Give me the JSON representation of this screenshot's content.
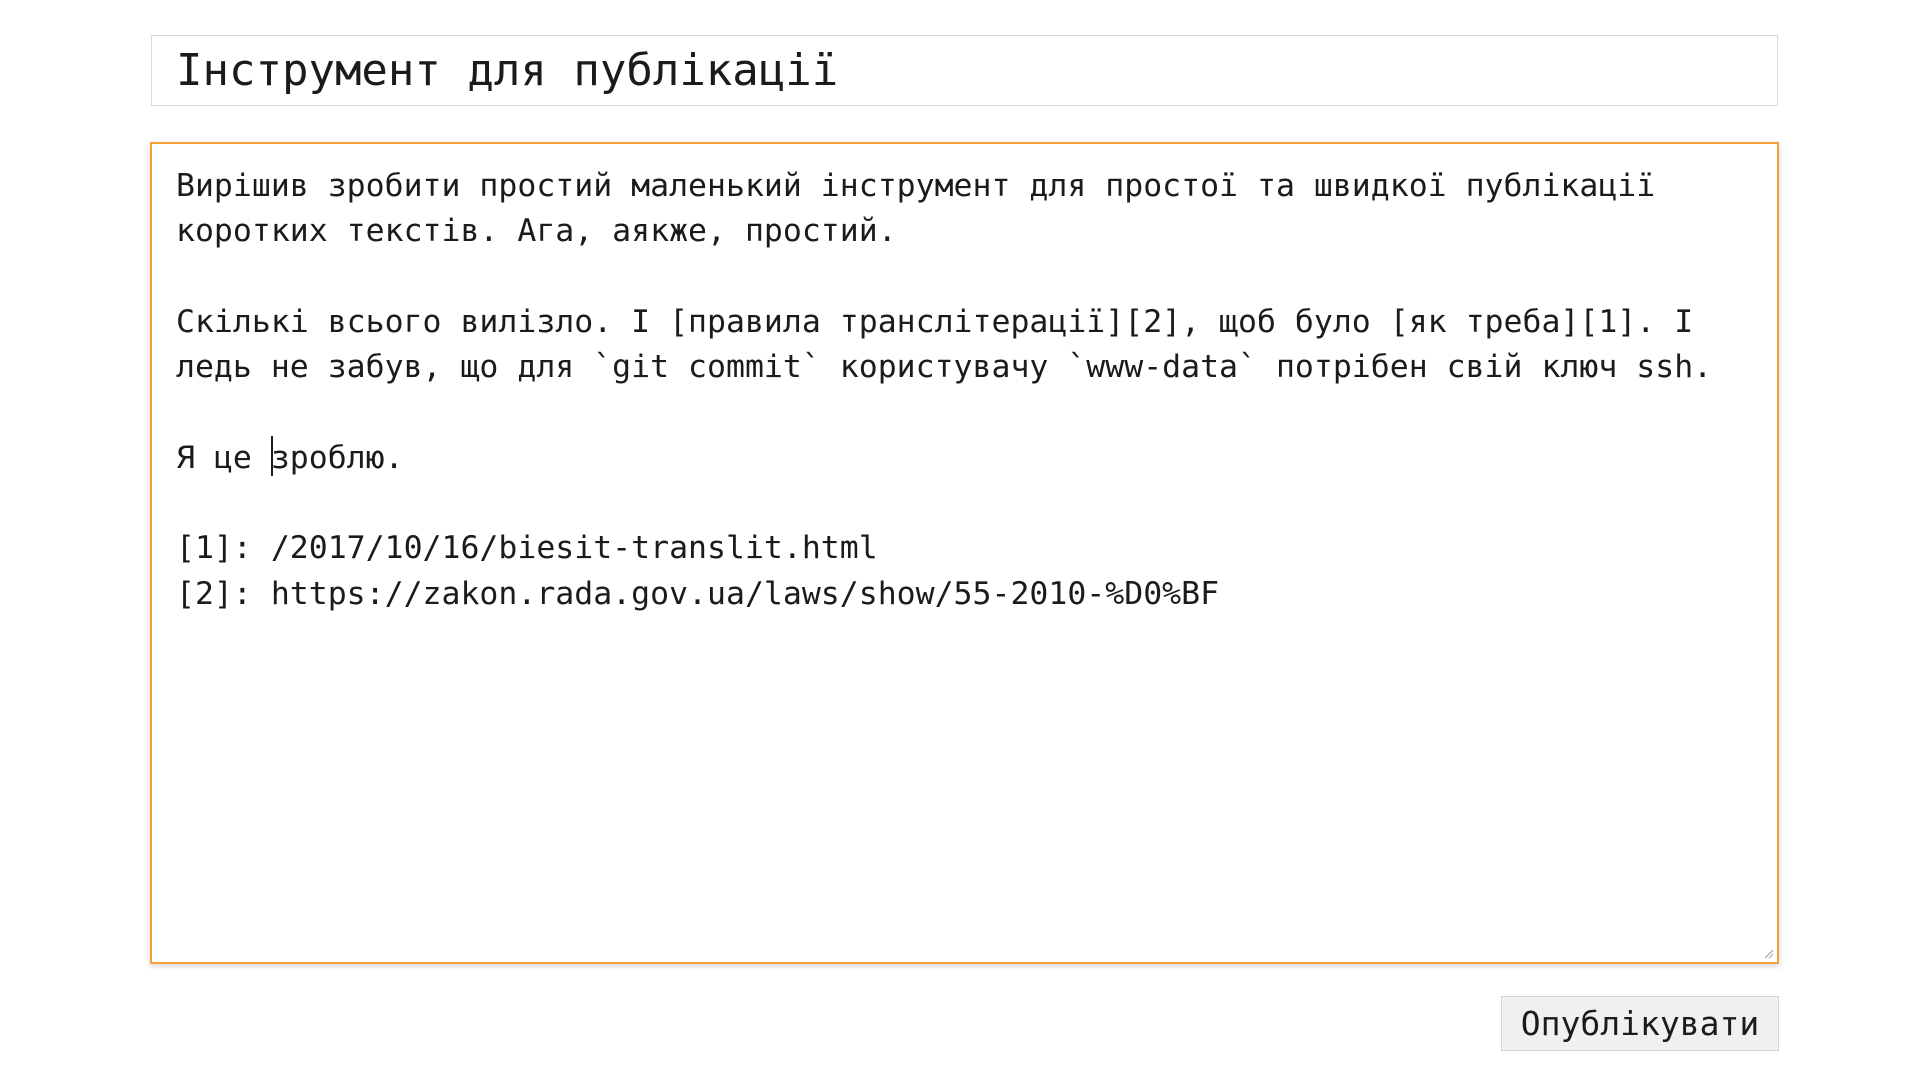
{
  "editor": {
    "title_value": "Інструмент для публікації",
    "body": {
      "line_1": "Вирішив зробити простий маленький інструмент для простої та швидкої публікації коротких текстів. Ага, аякже, простий.",
      "line_2": "Скількі всього вилізло. І [правила транслітерації][2], щоб було [як треба][1]. І ледь не забув, що для `git commit` користувачу `www-data` потрібен свій ключ ssh.",
      "line_3_before_caret": "Я це ",
      "line_3_after_caret": "зроблю.",
      "ref_1": "[1]: /2017/10/16/biesit-translit.html",
      "ref_2": "[2]: https://zakon.rada.gov.ua/laws/show/55-2010-%D0%BF"
    }
  },
  "actions": {
    "publish_label": "Опублікувати"
  },
  "colors": {
    "focus_border": "#f4a13a",
    "button_bg": "#f0f0f0"
  }
}
